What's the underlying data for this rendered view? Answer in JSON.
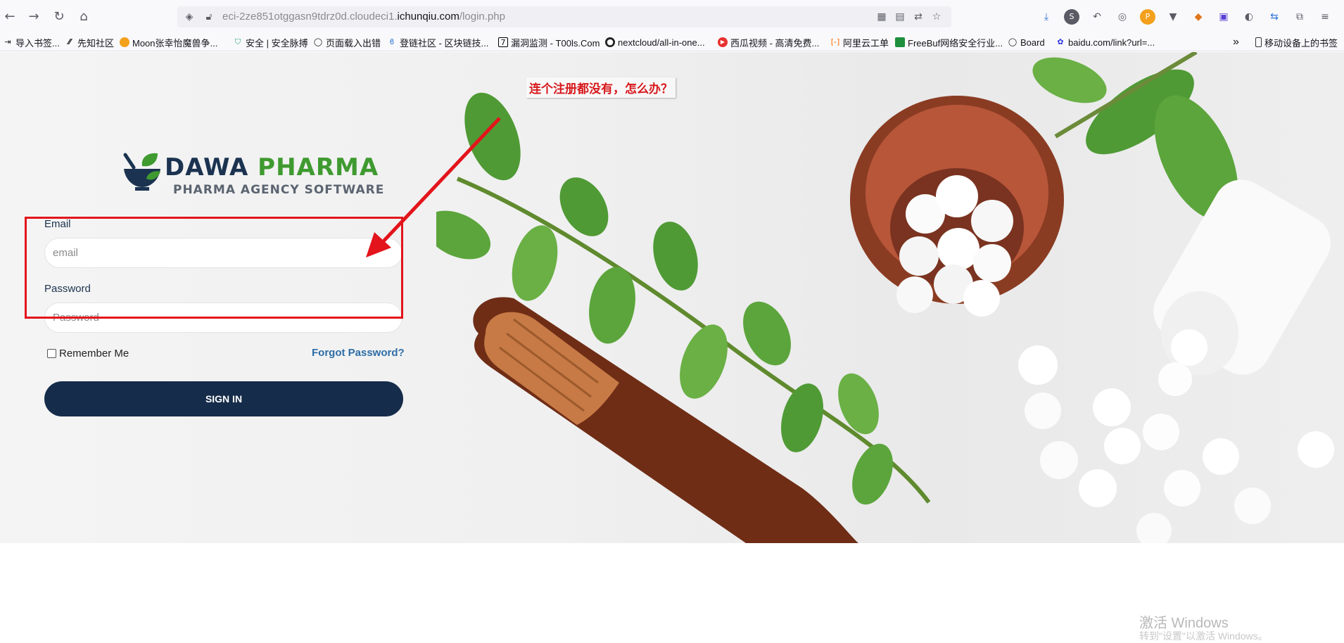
{
  "browser": {
    "url_prefix": "eci-2ze851otggasn9tdrz0d.cloudeci1.",
    "url_domain": "ichunqiu.com",
    "url_path": "/login.php",
    "bookmarks": [
      {
        "label": "导入书签..."
      },
      {
        "label": "先知社区"
      },
      {
        "label": "Moon张幸怡魔兽争..."
      },
      {
        "label": "安全 | 安全脉搏"
      },
      {
        "label": "页面载入出错"
      },
      {
        "label": "登链社区 - 区块链技..."
      },
      {
        "label": "漏洞监测 - T00ls.Com"
      },
      {
        "label": "nextcloud/all-in-one..."
      },
      {
        "label": "西瓜视频 - 高清免费..."
      },
      {
        "label": "阿里云工单"
      },
      {
        "label": "FreeBuf网络安全行业..."
      },
      {
        "label": "Board"
      },
      {
        "label": "baidu.com/link?url=..."
      }
    ],
    "overflow_label": "»",
    "mobile_bookmarks": "移动设备上的书签"
  },
  "login": {
    "brand_dawa": "DAWA",
    "brand_pharma": "PHARMA",
    "brand_subtitle": "PHARMA AGENCY SOFTWARE",
    "email_label": "Email",
    "email_placeholder": "email",
    "password_label": "Password",
    "password_placeholder": "Password",
    "remember_label": "Remember Me",
    "forgot_label": "Forgot Password?",
    "signin_label": "SIGN IN"
  },
  "annotation": {
    "text": "连个注册都没有，怎么办？",
    "color": "#e3141b"
  },
  "os": {
    "watermark": "激活 Windows",
    "watermark_sub": "转到\"设置\"以激活 Windows。"
  },
  "colors": {
    "brand_navy": "#152c4a",
    "brand_green": "#3f9a30",
    "link_blue": "#2d6da7"
  }
}
